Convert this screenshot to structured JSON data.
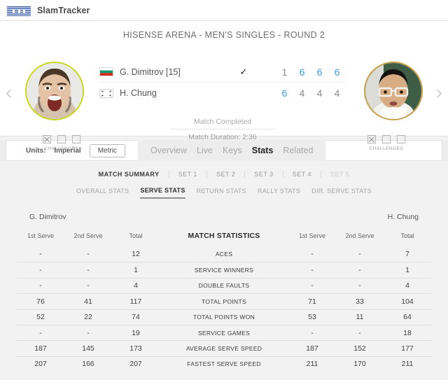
{
  "topbar": {
    "logo_name": "ibm-logo",
    "app_title": "SlamTracker"
  },
  "scoreboard": {
    "match_title": "HISENSE ARENA - MEN'S SINGLES - ROUND 2",
    "prev_arrow": "‹",
    "next_arrow": "›",
    "win_check": "✓",
    "status_main": "Match Completed",
    "status_sub": "Match Duration: 2:36",
    "players": [
      {
        "name": "G. Dimitrov [15]",
        "flag": "bulgaria-flag",
        "winner": true,
        "sets": [
          "1",
          "6",
          "6",
          "6"
        ],
        "set_won": [
          false,
          true,
          true,
          true
        ],
        "ring_color": "#c8d719"
      },
      {
        "name": "H. Chung",
        "flag": "south-korea-flag",
        "winner": false,
        "sets": [
          "6",
          "4",
          "4",
          "4"
        ],
        "set_won": [
          true,
          false,
          false,
          false
        ],
        "ring_color": "#c8a04a"
      }
    ],
    "challenges": {
      "label": "CHALLENGES",
      "left_used": [
        true,
        false,
        false
      ],
      "right_used": [
        true,
        false,
        false
      ]
    }
  },
  "navbar": {
    "units_label": "Units:",
    "unit_options": [
      "Imperial",
      "Metric"
    ],
    "unit_selected": "Metric",
    "tabs": [
      "Overview",
      "Live",
      "Keys",
      "Stats",
      "Related"
    ],
    "tab_active": "Stats"
  },
  "stats": {
    "set_tabs": [
      {
        "label": "MATCH SUMMARY",
        "state": "active"
      },
      {
        "label": "SET 1",
        "state": "normal"
      },
      {
        "label": "SET 2",
        "state": "normal"
      },
      {
        "label": "SET 3",
        "state": "normal"
      },
      {
        "label": "SET 4",
        "state": "normal"
      },
      {
        "label": "SET 5",
        "state": "disabled"
      }
    ],
    "sub_tabs": [
      {
        "label": "OVERALL STATS",
        "state": "normal"
      },
      {
        "label": "SERVE STATS",
        "state": "active"
      },
      {
        "label": "RETURN STATS",
        "state": "normal"
      },
      {
        "label": "RALLY STATS",
        "state": "normal"
      },
      {
        "label": "DIR. SERVE STATS",
        "state": "normal"
      }
    ],
    "table": {
      "left_player": "G. Dimitrov",
      "right_player": "H. Chung",
      "center_title": "MATCH STATISTICS",
      "columns": [
        "1st Serve",
        "2nd Serve",
        "Total"
      ],
      "rows": [
        {
          "label": "ACES",
          "left": [
            "-",
            "-",
            "12"
          ],
          "right": [
            "-",
            "-",
            "7"
          ]
        },
        {
          "label": "SERVICE WINNERS",
          "left": [
            "-",
            "-",
            "1"
          ],
          "right": [
            "-",
            "-",
            "1"
          ]
        },
        {
          "label": "DOUBLE FAULTS",
          "left": [
            "-",
            "-",
            "4"
          ],
          "right": [
            "-",
            "-",
            "4"
          ]
        },
        {
          "label": "TOTAL POINTS",
          "left": [
            "76",
            "41",
            "117"
          ],
          "right": [
            "71",
            "33",
            "104"
          ]
        },
        {
          "label": "TOTAL POINTS WON",
          "left": [
            "52",
            "22",
            "74"
          ],
          "right": [
            "53",
            "11",
            "64"
          ]
        },
        {
          "label": "SERVICE GAMES",
          "left": [
            "-",
            "-",
            "19"
          ],
          "right": [
            "-",
            "-",
            "18"
          ]
        },
        {
          "label": "AVERAGE SERVE SPEED",
          "left": [
            "187",
            "145",
            "173"
          ],
          "right": [
            "187",
            "152",
            "177"
          ]
        },
        {
          "label": "FASTEST SERVE SPEED",
          "left": [
            "207",
            "166",
            "207"
          ],
          "right": [
            "211",
            "170",
            "211"
          ]
        }
      ]
    }
  },
  "colors": {
    "ibm_blue": "#3b5fa8",
    "score_win": "#3b9fd8",
    "score_lose": "#8a8a8a",
    "page_bg": "#f2f2f2"
  }
}
